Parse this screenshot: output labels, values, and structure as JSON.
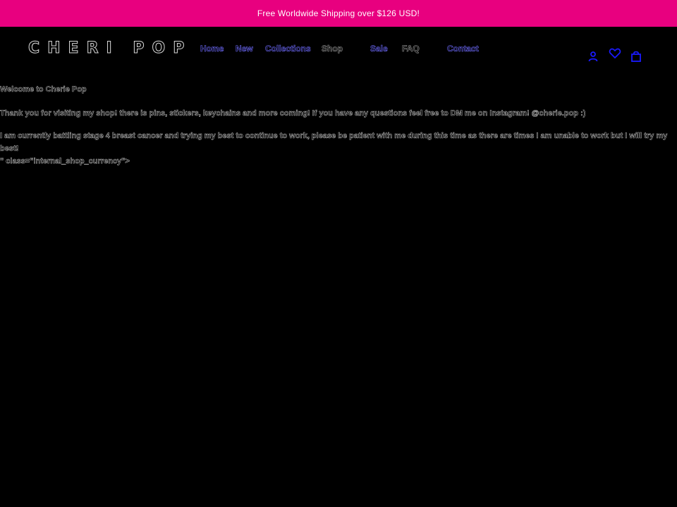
{
  "announcement": {
    "text": "Free Worldwide Shipping over $126 USD!"
  },
  "header": {
    "logo_text": "CHERI POP",
    "nav": [
      {
        "label": "Home"
      },
      {
        "label": "New"
      },
      {
        "label": "Collections"
      },
      {
        "label": "Shop"
      },
      {
        "label": "Sale"
      },
      {
        "label": "FAQ"
      },
      {
        "label": "Contact"
      }
    ],
    "icons": [
      "account-icon",
      "wishlist-heart-icon",
      "cart-bag-icon"
    ]
  },
  "content": {
    "heading": "Welcome to Cherie Pop",
    "paragraph_1": "Thank you for visiting my shop! there is pins, stickers, keychains and more coming! If you have any questions feel free to DM me on Instagram! @cherie.pop :)",
    "paragraph_2": "I am currently battling stage 4 breast cancer and trying my best to continue to work, please be patient with me during this time as there are times I am unable to work but I will try my best!",
    "stray_markup": "\" class=\"internal_shop_currency\">"
  },
  "colors": {
    "announcement_bg": "#e8007f",
    "page_bg": "#000000",
    "nav_accent": "#6f6bff",
    "icon_blue": "#1a1aff"
  }
}
